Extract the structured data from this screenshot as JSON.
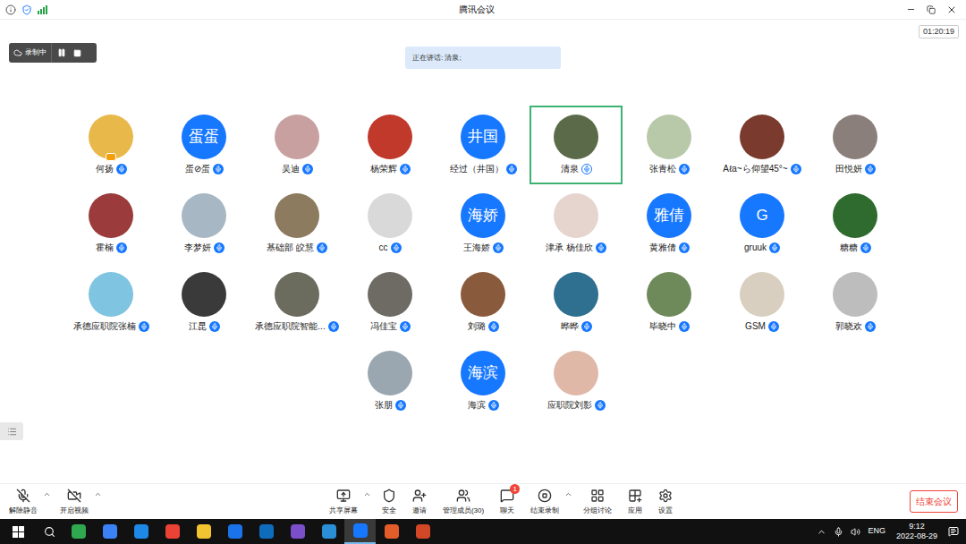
{
  "window": {
    "title": "腾讯会议",
    "timer": "01:20:19"
  },
  "recording": {
    "label": "录制中",
    "paused": false
  },
  "speaking": "正在讲话: 清泉;",
  "participants": [
    {
      "name": "何扬",
      "kind": "photo",
      "color": "#e8b84a",
      "host": true,
      "selected": false
    },
    {
      "name": "蛋⊘蛋",
      "kind": "text",
      "avatar": "蛋蛋",
      "host": false,
      "selected": false
    },
    {
      "name": "吴迪",
      "kind": "photo",
      "color": "#c9a0a0",
      "host": false,
      "selected": false
    },
    {
      "name": "杨荣辉",
      "kind": "photo",
      "color": "#c0392b",
      "host": false,
      "selected": false
    },
    {
      "name": "经过（井国）",
      "kind": "text",
      "avatar": "井国",
      "host": false,
      "selected": false
    },
    {
      "name": "清泉",
      "kind": "photo",
      "color": "#5b6b4a",
      "host": false,
      "selected": true
    },
    {
      "name": "张青松",
      "kind": "photo",
      "color": "#b7c9a8",
      "host": false,
      "selected": false
    },
    {
      "name": "Aℓa~ら仰望45°~",
      "kind": "photo",
      "color": "#7a3b2e",
      "host": false,
      "selected": false
    },
    {
      "name": "田悦妍",
      "kind": "photo",
      "color": "#8a7f7a",
      "host": false,
      "selected": false
    },
    {
      "name": "霍楠",
      "kind": "photo",
      "color": "#9b3b3b",
      "host": false,
      "selected": false
    },
    {
      "name": "李梦妍",
      "kind": "photo",
      "color": "#a8b7c4",
      "host": false,
      "selected": false
    },
    {
      "name": "基础部 皎慧",
      "kind": "photo",
      "color": "#8c7b5e",
      "host": false,
      "selected": false
    },
    {
      "name": "cc",
      "kind": "photo",
      "color": "#d9d9d9",
      "host": false,
      "selected": false
    },
    {
      "name": "王海娇",
      "kind": "text",
      "avatar": "海娇",
      "host": false,
      "selected": false
    },
    {
      "name": "津承 杨佳欣",
      "kind": "photo",
      "color": "#e6d5cf",
      "host": false,
      "selected": false
    },
    {
      "name": "黄雅倩",
      "kind": "text",
      "avatar": "雅倩",
      "host": false,
      "selected": false
    },
    {
      "name": "gruuk",
      "kind": "text",
      "avatar": "G",
      "host": false,
      "selected": false
    },
    {
      "name": "糖糖",
      "kind": "photo",
      "color": "#2f6b2f",
      "host": false,
      "selected": false
    },
    {
      "name": "承德应职院张楠",
      "kind": "photo",
      "color": "#7fc4e0",
      "host": false,
      "selected": false
    },
    {
      "name": "江昆",
      "kind": "photo",
      "color": "#3a3a3a",
      "host": false,
      "selected": false
    },
    {
      "name": "承德应职院智能...",
      "kind": "photo",
      "color": "#6b6b5e",
      "host": false,
      "selected": false
    },
    {
      "name": "冯佳宝",
      "kind": "photo",
      "color": "#6e6a64",
      "host": false,
      "selected": false
    },
    {
      "name": "刘璐",
      "kind": "photo",
      "color": "#8a5a3c",
      "host": false,
      "selected": false
    },
    {
      "name": "晔晔",
      "kind": "photo",
      "color": "#2f6f8f",
      "host": false,
      "selected": false
    },
    {
      "name": "毕晓中",
      "kind": "photo",
      "color": "#6f8a5a",
      "host": false,
      "selected": false
    },
    {
      "name": "GSM",
      "kind": "photo",
      "color": "#d8cfc0",
      "host": false,
      "selected": false
    },
    {
      "name": "郭晓欢",
      "kind": "photo",
      "color": "#bdbdbd",
      "host": false,
      "selected": false
    },
    {
      "name": "张朋",
      "kind": "photo",
      "color": "#9aa7b0",
      "host": false,
      "selected": false
    },
    {
      "name": "海滨",
      "kind": "text",
      "avatar": "海滨",
      "host": false,
      "selected": false
    },
    {
      "name": "应职院刘影",
      "kind": "photo",
      "color": "#e0b8a8",
      "host": false,
      "selected": false
    }
  ],
  "toolbar_left": [
    {
      "label": "解除静音",
      "icon": "mic-off",
      "has_menu": true
    },
    {
      "label": "开启视频",
      "icon": "video-off",
      "has_menu": true
    }
  ],
  "toolbar_center": [
    {
      "label": "共享屏幕",
      "icon": "share",
      "has_menu": true,
      "badge": ""
    },
    {
      "label": "安全",
      "icon": "shield",
      "has_menu": false,
      "badge": ""
    },
    {
      "label": "邀请",
      "icon": "invite",
      "has_menu": false,
      "badge": ""
    },
    {
      "label": "管理成员(30)",
      "icon": "members",
      "has_menu": false,
      "badge": ""
    },
    {
      "label": "聊天",
      "icon": "chat",
      "has_menu": false,
      "badge": "1"
    },
    {
      "label": "结束录制",
      "icon": "stop",
      "has_menu": true,
      "badge": ""
    },
    {
      "label": "分组讨论",
      "icon": "groups",
      "has_menu": false,
      "badge": ""
    },
    {
      "label": "应用",
      "icon": "apps",
      "has_menu": false,
      "badge": ""
    },
    {
      "label": "设置",
      "icon": "settings",
      "has_menu": false,
      "badge": ""
    }
  ],
  "end_button": "结束会议",
  "taskbar": {
    "apps": [
      {
        "color": "#2fa84f",
        "selected": false
      },
      {
        "color": "#3b82f6",
        "selected": false
      },
      {
        "color": "#1e88e5",
        "selected": false
      },
      {
        "color": "#ea4335",
        "selected": false
      },
      {
        "color": "#f4c430",
        "selected": false
      },
      {
        "color": "#1a73e8",
        "selected": false
      },
      {
        "color": "#0f6cbd",
        "selected": false
      },
      {
        "color": "#7b4fc9",
        "selected": false
      },
      {
        "color": "#2b8fd6",
        "selected": false
      },
      {
        "color": "#1677ff",
        "selected": true
      },
      {
        "color": "#e35d2a",
        "selected": false
      },
      {
        "color": "#d24726",
        "selected": false
      }
    ],
    "lang": "ENG",
    "time": "9:12",
    "date": "2022-08-29"
  }
}
